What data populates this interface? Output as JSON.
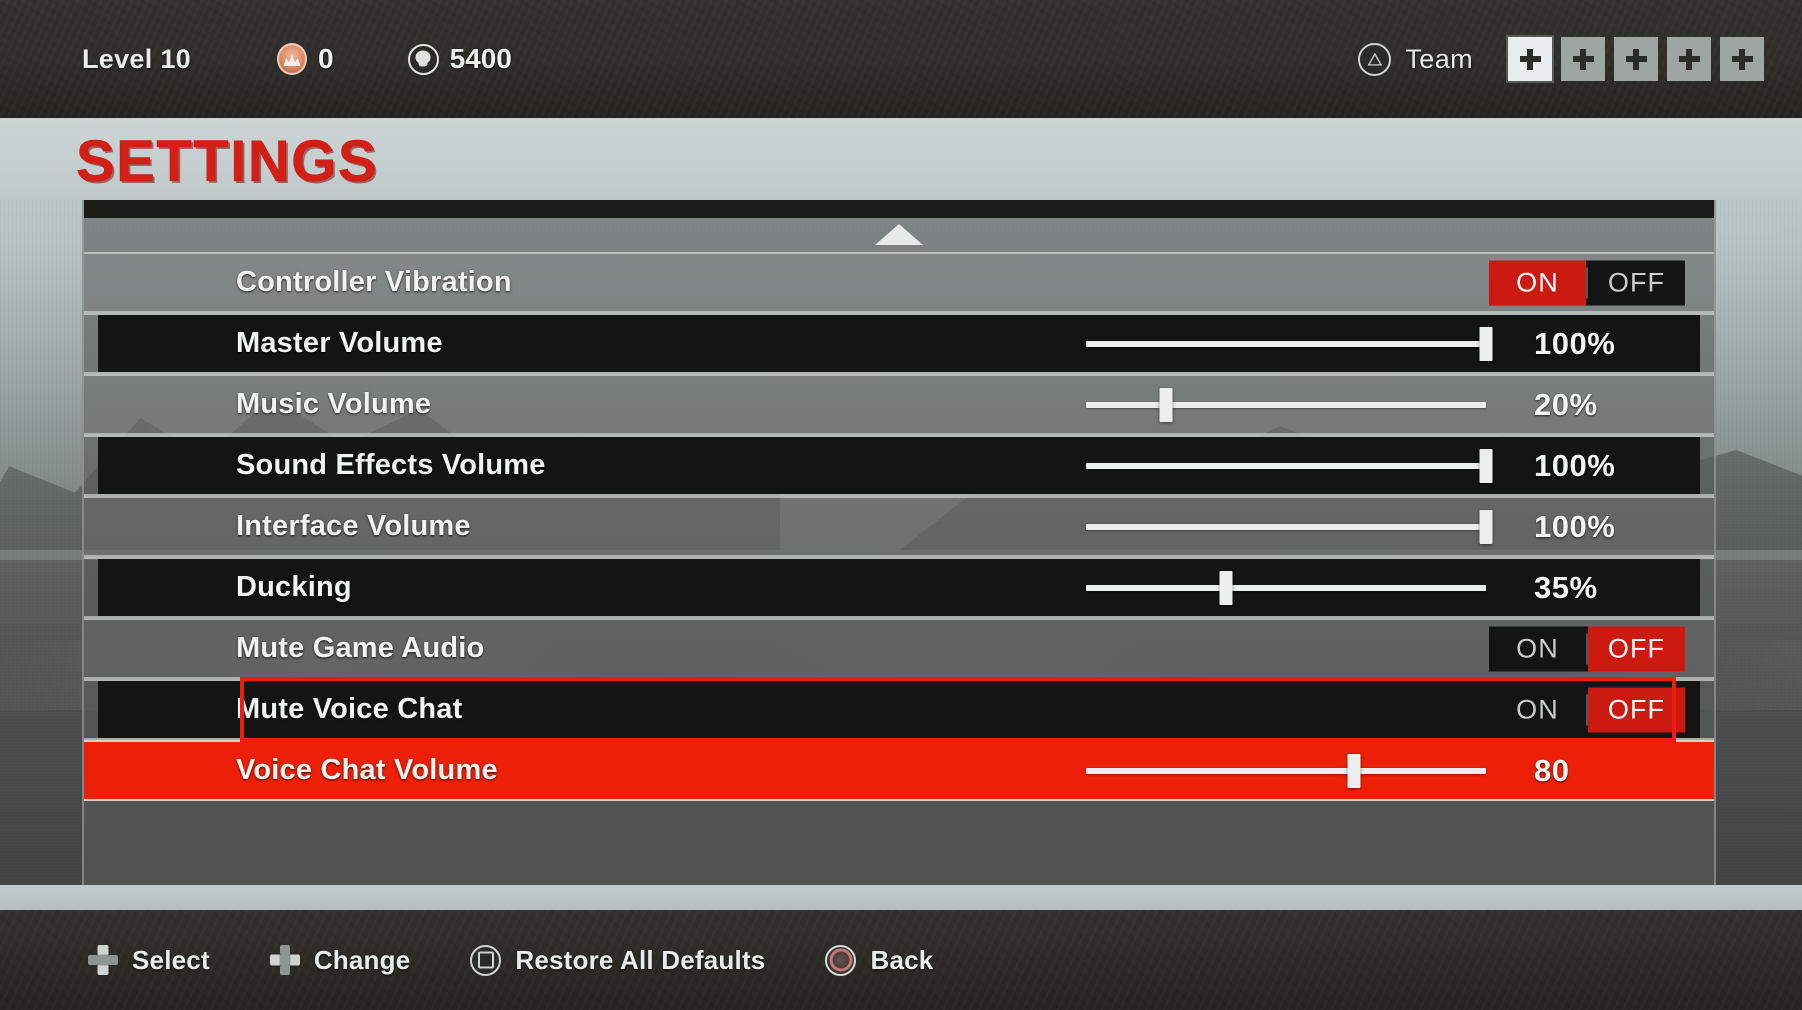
{
  "hud": {
    "level_label": "Level 10",
    "bandit_icon": "bandit-icon",
    "bandit_count": "0",
    "skull_icon": "skull-icon",
    "skull_count": "5400",
    "team_icon": "playstation-triangle-icon",
    "team_label": "Team",
    "team_slots": [
      {
        "icon": "plus-icon",
        "state": "bright"
      },
      {
        "icon": "plus-icon",
        "state": "dim"
      },
      {
        "icon": "plus-icon",
        "state": "dim"
      },
      {
        "icon": "plus-icon",
        "state": "dim"
      },
      {
        "icon": "plus-icon",
        "state": "dim"
      }
    ]
  },
  "page": {
    "title": "SETTINGS",
    "title_color": "#d41f16",
    "accent_color": "#cc1a11",
    "selected_row_color": "#ed2007",
    "scroll_up_icon": "scroll-up-arrow-icon"
  },
  "settings": {
    "rows": [
      {
        "label": "Controller Vibration",
        "type": "toggle",
        "on_label": "ON",
        "off_label": "OFF",
        "value": "ON",
        "bg": "light"
      },
      {
        "label": "Master Volume",
        "type": "slider",
        "value": "100%",
        "percent": 100,
        "bg": "dark"
      },
      {
        "label": "Music Volume",
        "type": "slider",
        "value": "20%",
        "percent": 20,
        "bg": "light"
      },
      {
        "label": "Sound Effects Volume",
        "type": "slider",
        "value": "100%",
        "percent": 100,
        "bg": "dark"
      },
      {
        "label": "Interface Volume",
        "type": "slider",
        "value": "100%",
        "percent": 100,
        "bg": "light"
      },
      {
        "label": "Ducking",
        "type": "slider",
        "value": "35%",
        "percent": 35,
        "bg": "dark"
      },
      {
        "label": "Mute Game Audio",
        "type": "toggle",
        "on_label": "ON",
        "off_label": "OFF",
        "value": "OFF",
        "bg": "light"
      },
      {
        "label": "Mute Voice Chat",
        "type": "toggle",
        "on_label": "ON",
        "off_label": "OFF",
        "value": "OFF",
        "bg": "dark",
        "annotated": true
      },
      {
        "label": "Voice Chat Volume",
        "type": "slider",
        "value": "80",
        "percent": 67,
        "bg": "selected"
      }
    ]
  },
  "footer": {
    "hints": [
      {
        "icon": "dpad-vertical-icon",
        "label": "Select"
      },
      {
        "icon": "dpad-horizontal-icon",
        "label": "Change"
      },
      {
        "icon": "playstation-square-icon",
        "label": "Restore All Defaults"
      },
      {
        "icon": "playstation-circle-icon",
        "label": "Back"
      }
    ]
  }
}
